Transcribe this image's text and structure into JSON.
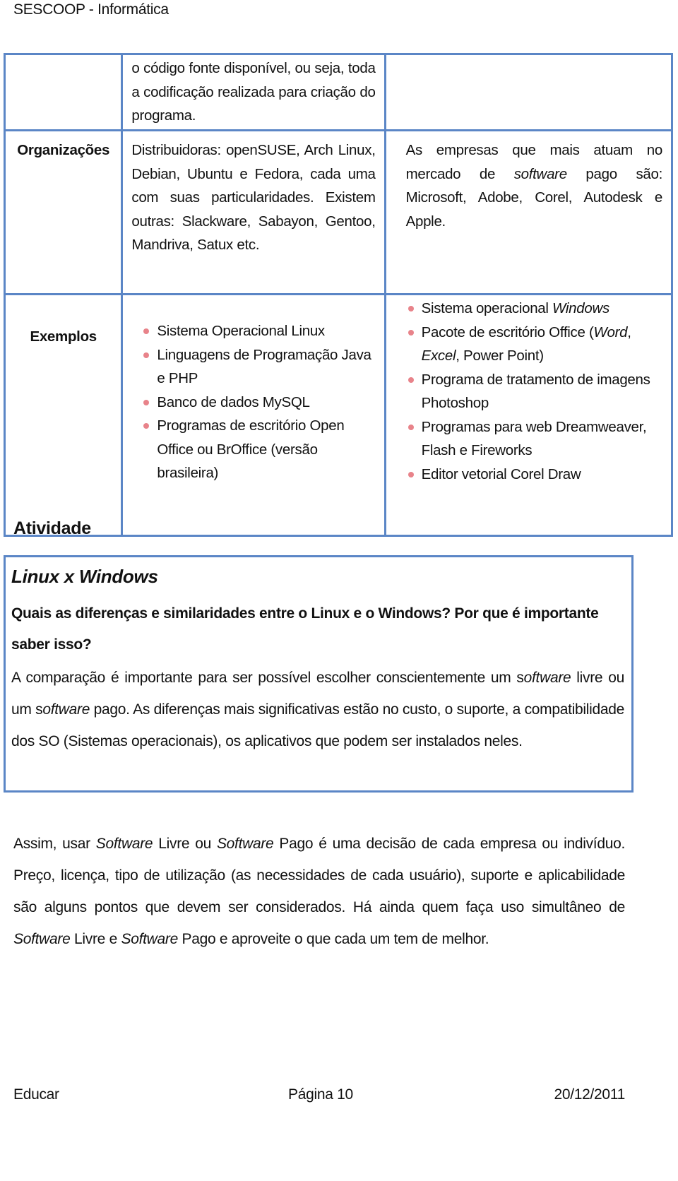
{
  "header": {
    "title": "SESCOOP - Informática"
  },
  "comparison_table": {
    "rows": [
      {
        "label": "",
        "free": "o código fonte disponível, ou seja, toda a codificação realizada para criação do programa.",
        "paid": ""
      },
      {
        "label": "Organizações",
        "free": "Distribuidoras: openSUSE, Arch Linux, Debian, Ubuntu e Fedora, cada uma com suas particularidades. Existem outras: Slackware, Sabayon, Gentoo, Mandriva, Satux etc.",
        "paid_parts": [
          "As empresas que mais atuam no mercado de ",
          "software",
          " pago são: Microsoft, Adobe, Corel, Autodesk e Apple."
        ]
      },
      {
        "label": "Exemplos",
        "free_items": [
          "Sistema Operacional Linux",
          "Linguagens de Programação Java e PHP",
          "Banco de dados MySQL",
          "Programas de escritório Open Office ou BrOffice (versão brasileira)"
        ],
        "paid_items": [
          {
            "parts": [
              "Sistema operacional ",
              "Windows"
            ]
          },
          {
            "parts": [
              "Pacote de escritório Office (",
              "Word",
              ", ",
              "Excel",
              ", Power Point)"
            ]
          },
          {
            "parts": [
              "Programa de tratamento de imagens Photoshop"
            ]
          },
          {
            "parts": [
              "Programas para web Dreamweaver, Flash e Fireworks"
            ]
          },
          {
            "parts": [
              "Editor vetorial Corel Draw"
            ]
          }
        ]
      }
    ],
    "bullet_color": "#e8838a",
    "border_color": "#5b86c6"
  },
  "activity": {
    "section_title": "Atividade",
    "heading": "Linux x Windows",
    "question": "Quais as diferenças e similaridades entre o Linux e o Windows? Por que é importante saber isso?",
    "answer_parts": [
      "A comparação é importante para ser possível escolher conscientemente um s",
      "oftware",
      " livre ou um s",
      "oftware",
      " pago. As diferenças mais significativas estão no custo, o suporte, a compatibilidade dos SO (Sistemas operacionais), os aplicativos que podem ser instalados neles."
    ]
  },
  "closing_paragraph_parts": [
    "Assim, usar ",
    "Software",
    " Livre ou ",
    "Software",
    " Pago é uma decisão de cada empresa ou indivíduo. Preço, licença, tipo de utilização (as necessidades de cada usuário), suporte e aplicabilidade são alguns pontos que devem ser considerados. Há ainda quem faça uso simultâneo de ",
    "Software",
    " Livre e ",
    "Software",
    " Pago e aproveite o que cada um tem de melhor."
  ],
  "footer": {
    "left": "Educar",
    "center": "Página 10",
    "right": "20/12/2011"
  }
}
